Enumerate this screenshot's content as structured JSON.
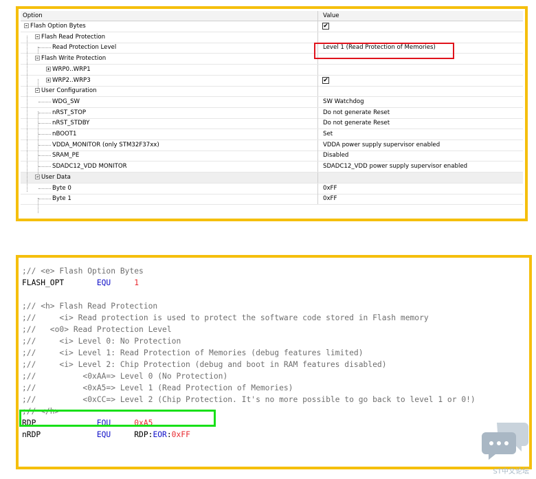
{
  "options_panel": {
    "headers": {
      "option": "Option",
      "value": "Value"
    },
    "rows": [
      {
        "label": "Flash Option Bytes",
        "value": "",
        "checkbox": true,
        "checked": true
      },
      {
        "label": "Flash Read Protection",
        "value": ""
      },
      {
        "label": "Read Protection Level",
        "value": "Level 1 (Read Protection of Memories)"
      },
      {
        "label": "Flash Write Protection",
        "value": ""
      },
      {
        "label": "WRP0..WRP1",
        "value": ""
      },
      {
        "label": "WRP2..WRP3",
        "value": "",
        "checkbox": true,
        "checked": true
      },
      {
        "label": "User Configuration",
        "value": ""
      },
      {
        "label": "WDG_SW",
        "value": "SW Watchdog"
      },
      {
        "label": "nRST_STOP",
        "value": "Do not generate Reset"
      },
      {
        "label": "nRST_STDBY",
        "value": "Do not generate Reset"
      },
      {
        "label": "nBOOT1",
        "value": "Set"
      },
      {
        "label": "VDDA_MONITOR (only STM32F37xx)",
        "value": "VDDA power supply supervisor enabled"
      },
      {
        "label": "SRAM_PE",
        "value": "Disabled"
      },
      {
        "label": "SDADC12_VDD MONITOR",
        "value": "SDADC12_VDD power supply supervisor enabled"
      },
      {
        "label": "User Data",
        "value": ""
      },
      {
        "label": "Byte 0",
        "value": "0xFF"
      },
      {
        "label": "Byte 1",
        "value": "0xFF"
      }
    ]
  },
  "code_panel": {
    "lines": [
      [
        {
          "t": ";// <e> Flash Option Bytes",
          "c": "cmt"
        }
      ],
      [
        {
          "t": "FLASH_OPT       ",
          "c": ""
        },
        {
          "t": "EQU",
          "c": "kw"
        },
        {
          "t": "     ",
          "c": ""
        },
        {
          "t": "1",
          "c": "num"
        }
      ],
      [
        {
          "t": "",
          "c": ""
        }
      ],
      [
        {
          "t": ";// <h> Flash Read Protection",
          "c": "cmt"
        }
      ],
      [
        {
          "t": ";//     <i> Read protection is used to protect the software code stored in Flash memory",
          "c": "cmt"
        }
      ],
      [
        {
          "t": ";//   <o0> Read Protection Level",
          "c": "cmt"
        }
      ],
      [
        {
          "t": ";//     <i> Level 0: No Protection",
          "c": "cmt"
        }
      ],
      [
        {
          "t": ";//     <i> Level 1: Read Protection of Memories (debug features limited)",
          "c": "cmt"
        }
      ],
      [
        {
          "t": ";//     <i> Level 2: Chip Protection (debug and boot in RAM features disabled)",
          "c": "cmt"
        }
      ],
      [
        {
          "t": ";//          <0xAA=> Level 0 (No Protection)",
          "c": "cmt"
        }
      ],
      [
        {
          "t": ";//          <0xA5=> Level 1 (Read Protection of Memories)",
          "c": "cmt"
        }
      ],
      [
        {
          "t": ";//          <0xCC=> Level 2 (Chip Protection. It's no more possible to go back to level 1 or 0!)",
          "c": "cmt"
        }
      ],
      [
        {
          "t": ";// </h>",
          "c": "cmt"
        }
      ],
      [
        {
          "t": "RDP             ",
          "c": ""
        },
        {
          "t": "EQU",
          "c": "kw"
        },
        {
          "t": "     ",
          "c": ""
        },
        {
          "t": "0xA5",
          "c": "num"
        }
      ],
      [
        {
          "t": "nRDP            ",
          "c": ""
        },
        {
          "t": "EQU",
          "c": "kw"
        },
        {
          "t": "     RDP:",
          "c": ""
        },
        {
          "t": "EOR",
          "c": "kw"
        },
        {
          "t": ":",
          "c": ""
        },
        {
          "t": "0xFF",
          "c": "num"
        }
      ]
    ]
  },
  "watermark": {
    "text": "ST中文论坛",
    "icon": "chat-bubble-icon"
  },
  "colors": {
    "panel_border": "#f5bf0d",
    "highlight_red": "#e0121b",
    "highlight_green": "#18e018",
    "keyword": "#1010c8",
    "number": "#e8282e",
    "comment": "#6e6e6e"
  }
}
